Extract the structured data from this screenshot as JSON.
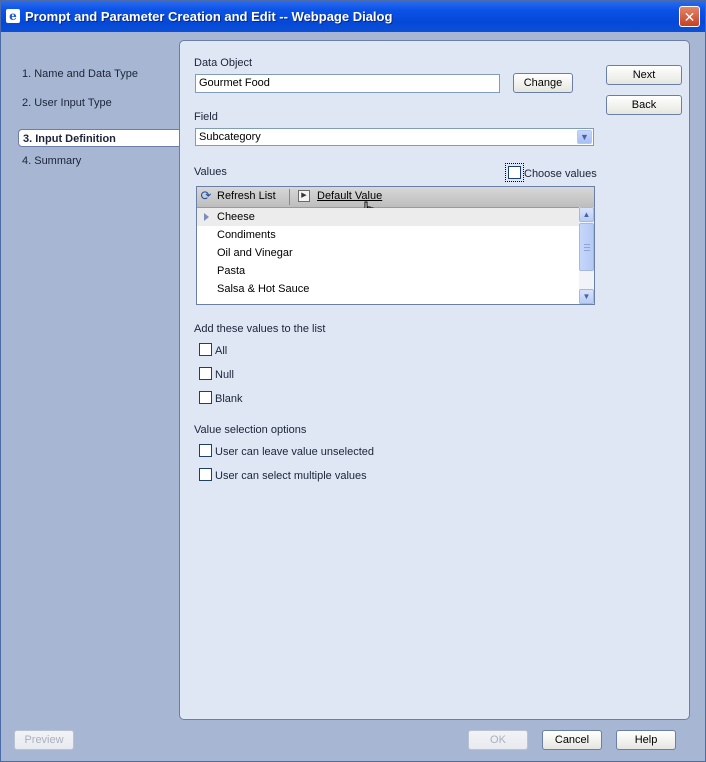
{
  "window": {
    "title": "Prompt and Parameter Creation and Edit -- Webpage Dialog",
    "close_glyph": "✕"
  },
  "nav": {
    "items": [
      {
        "label": "1. Name and Data Type"
      },
      {
        "label": "2. User Input Type"
      },
      {
        "label": "3. Input Definition"
      },
      {
        "label": "4. Summary"
      }
    ],
    "active_index": 2
  },
  "form": {
    "data_object_label": "Data Object",
    "data_object_value": "Gourmet Food",
    "change_label": "Change",
    "field_label": "Field",
    "field_value": "Subcategory",
    "values_label": "Values",
    "choose_values_label": "Choose values",
    "toolbar": {
      "refresh_label": "Refresh List",
      "default_value_label": "Default Value"
    },
    "values_list": [
      "Cheese",
      "Condiments",
      "Oil and Vinegar",
      "Pasta",
      "Salsa & Hot Sauce"
    ],
    "add_values_heading": "Add these values to the list",
    "add_values": [
      {
        "label": "All",
        "checked": false
      },
      {
        "label": "Null",
        "checked": false
      },
      {
        "label": "Blank",
        "checked": false
      }
    ],
    "selection_heading": "Value selection options",
    "selection_options": [
      {
        "label": "User can leave value unselected",
        "checked": false
      },
      {
        "label": "User can select multiple values",
        "checked": false
      }
    ]
  },
  "side_buttons": {
    "next": "Next",
    "back": "Back"
  },
  "footer": {
    "preview": "Preview",
    "ok": "OK",
    "cancel": "Cancel",
    "help": "Help"
  },
  "icons": {
    "title": "ie-icon",
    "refresh": "refresh-icon",
    "default_value": "play-icon",
    "cursor": "hand-cursor-icon"
  },
  "colors": {
    "titlebar": "#0548d8",
    "panel_bg": "#dfe7f4",
    "window_bg": "#a7b7d3"
  }
}
